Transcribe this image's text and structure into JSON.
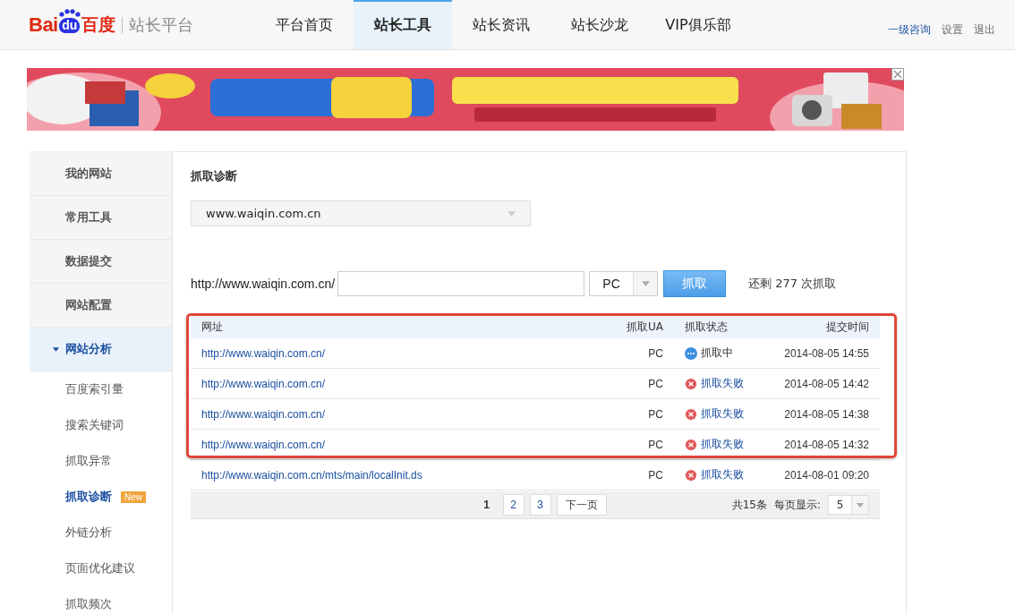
{
  "header": {
    "logo": {
      "bai": "Bai",
      "du": "du",
      "baidu_cn": "百度",
      "product": "站长平台"
    },
    "nav": [
      {
        "label": "平台首页",
        "selected": false
      },
      {
        "label": "站长工具",
        "selected": true
      },
      {
        "label": "站长资讯",
        "selected": false
      },
      {
        "label": "站长沙龙",
        "selected": false
      },
      {
        "label": "VIP俱乐部",
        "selected": false
      }
    ],
    "links": [
      {
        "label": "一级咨询",
        "kind": "primary"
      },
      {
        "label": "设置",
        "kind": "plain"
      },
      {
        "label": "退出",
        "kind": "plain"
      }
    ]
  },
  "sidebar": {
    "items": [
      {
        "label": "我的网站",
        "expanded": false
      },
      {
        "label": "常用工具",
        "expanded": false
      },
      {
        "label": "数据提交",
        "expanded": false
      },
      {
        "label": "网站配置",
        "expanded": false
      },
      {
        "label": "网站分析",
        "expanded": true,
        "children": [
          {
            "label": "百度索引量",
            "selected": false
          },
          {
            "label": "搜索关键词",
            "selected": false
          },
          {
            "label": "抓取异常",
            "selected": false
          },
          {
            "label": "抓取诊断",
            "selected": true,
            "badge": "New"
          },
          {
            "label": "外链分析",
            "selected": false
          },
          {
            "label": "页面优化建议",
            "selected": false
          },
          {
            "label": "抓取频次",
            "selected": false
          }
        ]
      }
    ]
  },
  "content": {
    "title": "抓取诊断",
    "site_select": {
      "value": "www.waiqin.com.cn"
    },
    "fetch_form": {
      "url_prefix": "http://www.waiqin.com.cn/",
      "ua_select": {
        "value": "PC"
      },
      "button": "抓取",
      "remaining": "还剩 277 次抓取"
    },
    "table": {
      "columns": [
        "网址",
        "抓取UA",
        "抓取状态",
        "提交时间"
      ],
      "rows": [
        {
          "url": "http://www.waiqin.com.cn/",
          "ua": "PC",
          "status": "抓取中",
          "kind": "pending",
          "time": "2014-08-05 14:55"
        },
        {
          "url": "http://www.waiqin.com.cn/",
          "ua": "PC",
          "status": "抓取失败",
          "kind": "failed",
          "time": "2014-08-05 14:42"
        },
        {
          "url": "http://www.waiqin.com.cn/",
          "ua": "PC",
          "status": "抓取失败",
          "kind": "failed",
          "time": "2014-08-05 14:38"
        },
        {
          "url": "http://www.waiqin.com.cn/",
          "ua": "PC",
          "status": "抓取失败",
          "kind": "failed",
          "time": "2014-08-05 14:32"
        },
        {
          "url": "http://www.waiqin.com.cn/mts/main/localInit.ds",
          "ua": "PC",
          "status": "抓取失败",
          "kind": "failed",
          "time": "2014-08-01 09:20"
        }
      ]
    },
    "pagination": {
      "pages": [
        {
          "label": "1",
          "selected": true
        },
        {
          "label": "2",
          "selected": false
        },
        {
          "label": "3",
          "selected": false
        }
      ],
      "next": "下一页",
      "total": "共15条",
      "per_page_label": "每页显示:",
      "per_page": {
        "value": "5"
      }
    }
  }
}
